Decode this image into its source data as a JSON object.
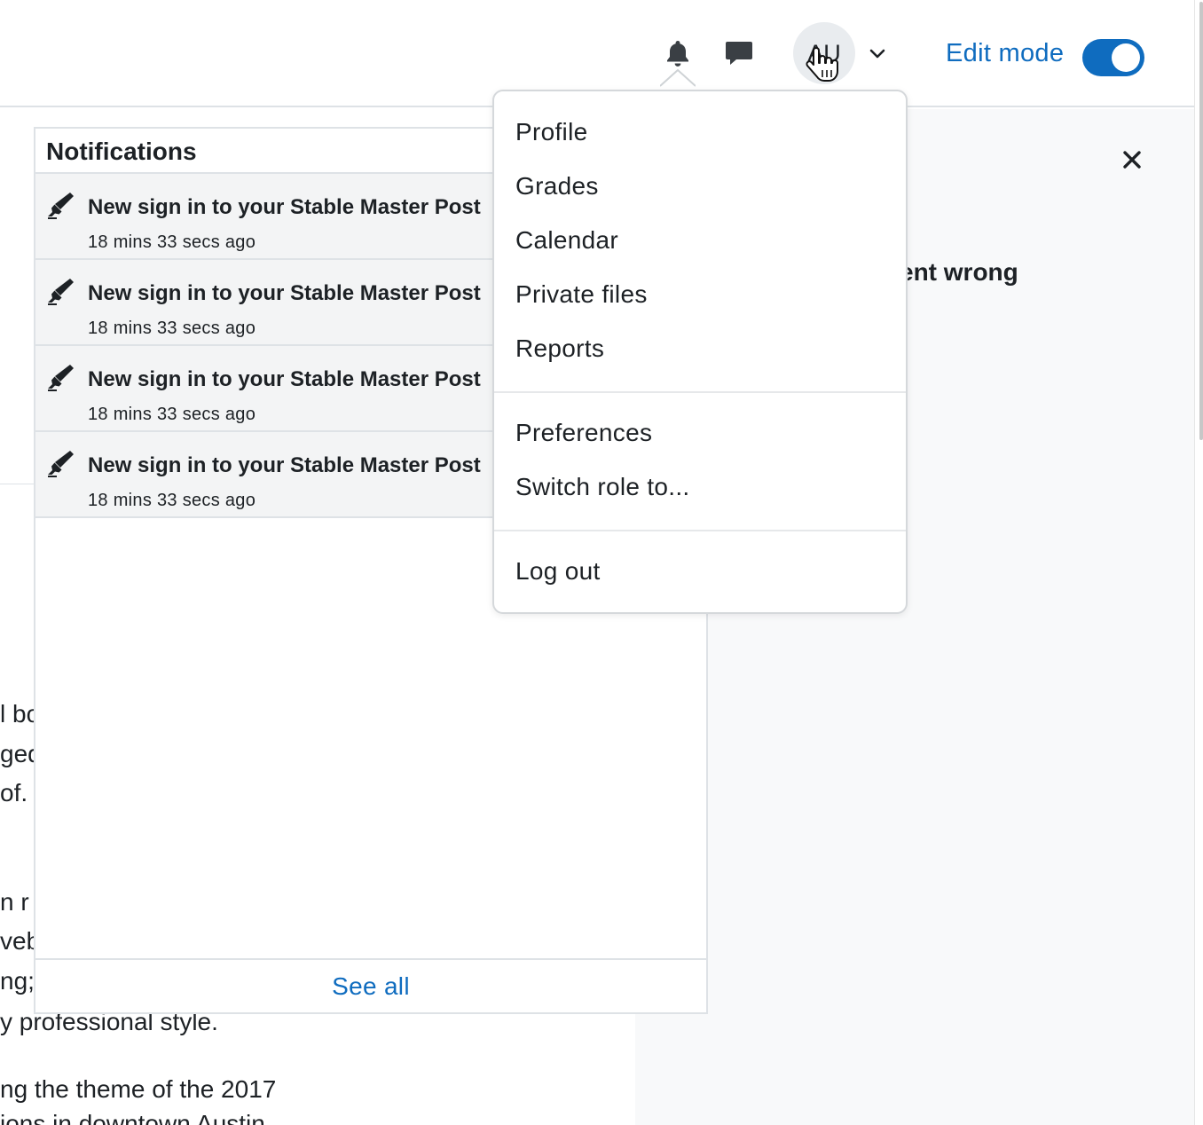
{
  "navbar": {
    "avatar_initials": "AU",
    "edit_mode_label": "Edit mode",
    "edit_mode_on": true,
    "colors": {
      "accent": "#0f6cbf",
      "text": "#1d2125",
      "notification_bg": "#f3f4f5",
      "drawer_bg": "#f8f9fa"
    }
  },
  "notifications": {
    "heading": "Notifications",
    "items": [
      {
        "title": "New sign in to your Stable Master Post",
        "time": "18 mins 33 secs ago",
        "icon": "edit-marker-icon"
      },
      {
        "title": "New sign in to your Stable Master Post",
        "time": "18 mins 33 secs ago",
        "icon": "edit-marker-icon"
      },
      {
        "title": "New sign in to your Stable Master Post",
        "time": "18 mins 33 secs ago",
        "icon": "edit-marker-icon"
      },
      {
        "title": "New sign in to your Stable Master Post",
        "time": "18 mins 33 secs ago",
        "icon": "edit-marker-icon"
      }
    ],
    "see_all": "See all"
  },
  "user_menu": {
    "group1": [
      "Profile",
      "Grades",
      "Calendar",
      "Private files",
      "Reports"
    ],
    "group2": [
      "Preferences",
      "Switch role to..."
    ],
    "group3": [
      "Log out"
    ]
  },
  "drawer": {
    "heading_fragment": "ent wrong"
  },
  "background_text": {
    "left_fragments": [
      "l bo",
      "ged",
      " of.",
      "n r",
      "veb",
      "ng;"
    ],
    "line1": "y professional style.",
    "line2": "ng the theme of the 2017",
    "line3": "ions in downtown Austin"
  }
}
